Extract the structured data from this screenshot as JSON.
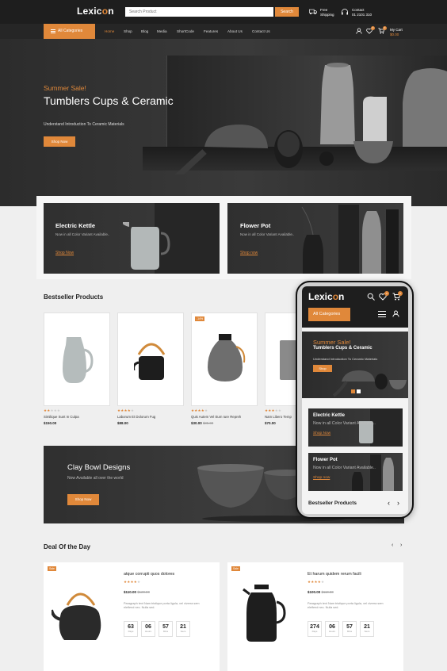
{
  "header": {
    "logo_prefix": "Lexic",
    "logo_o": "o",
    "logo_suffix": "n",
    "search_placeholder": "Search Product",
    "search_button": "Search",
    "free_shipping_1": "Free",
    "free_shipping_2": "Shipping",
    "contact_1": "Contact",
    "contact_2": "01 2101 310",
    "cart_label": "My Cart",
    "cart_total": "$0.00",
    "wishlist_count": "0",
    "cart_count": "0"
  },
  "nav": {
    "all_categories": "All Categories",
    "items": [
      "Home",
      "Shop",
      "Blog",
      "Media",
      "ShortCode",
      "Features",
      "About Us",
      "Contact Us"
    ]
  },
  "hero": {
    "subtitle": "Summer Sale!",
    "title": "Tumblers Cups & Ceramic",
    "description": "Understand Introduction To Ceramic Materials",
    "button": "Shop Now"
  },
  "banners": [
    {
      "title": "Electric Kettle",
      "desc": "Now in all Color Variant Available..",
      "link": "Shop Now"
    },
    {
      "title": "Flower Pot",
      "desc": "Now in all Color Variant Available..",
      "link": "Shop now"
    }
  ],
  "bestseller": {
    "title": "Bestseller Products",
    "products": [
      {
        "name": "Similique Sunt In Culpa",
        "price": "$150.00",
        "old_price": "",
        "rating": 2,
        "badge": ""
      },
      {
        "name": "Laborum Et Dolorum Fug",
        "price": "$88.00",
        "old_price": "",
        "rating": 4,
        "badge": ""
      },
      {
        "name": "Quis Autem Vel Eum Iure Repreh",
        "price": "$30.00",
        "old_price": "$35.00",
        "rating": 4,
        "badge": "-14%"
      },
      {
        "name": "Nam Libero Temp",
        "price": "$70.00",
        "old_price": "",
        "rating": 3,
        "badge": ""
      }
    ]
  },
  "clay": {
    "title": "Clay Bowl Designs",
    "desc": "Now Available all over the world",
    "button": "Shop Now"
  },
  "deal": {
    "title": "Deal Of the Day",
    "items": [
      {
        "badge": "Sale",
        "name": "atque corrupti quos dolores",
        "price": "$110.00",
        "old_price": "$120.00",
        "rating": 4,
        "desc": "Paragraph text Nam tristique porta ligula, vel viverra sem eleifend nec. Nulla sed.",
        "timer": [
          {
            "n": "63",
            "l": "Days"
          },
          {
            "n": "06",
            "l": "Hours"
          },
          {
            "n": "57",
            "l": "Mins"
          },
          {
            "n": "21",
            "l": "Secs"
          }
        ]
      },
      {
        "badge": "Sale",
        "name": "Et harum quidem rerum facili",
        "price": "$100.00",
        "old_price": "$110.00",
        "rating": 4,
        "desc": "Paragraph text Nam tristique porta ligula, vel viverra sem eleifend nec. Nulla sed.",
        "timer": [
          {
            "n": "274",
            "l": "Days"
          },
          {
            "n": "06",
            "l": "Hours"
          },
          {
            "n": "57",
            "l": "Mins"
          },
          {
            "n": "21",
            "l": "Secs"
          }
        ]
      }
    ]
  },
  "phone": {
    "logo_prefix": "Lexic",
    "logo_o": "o",
    "logo_suffix": "n",
    "all_categories": "All Categories",
    "hero_subtitle": "Summer Sale!",
    "hero_title": "Tumblers Cups & Ceramic",
    "hero_desc": "Understand Introduction To Ceramic Materials",
    "hero_button": "Shop",
    "banner1_title": "Electric Kettle",
    "banner1_desc": "Now in all Color Variant Available..",
    "banner1_link": "Shop Now",
    "banner2_title": "Flower Pot",
    "banner2_desc": "Now in all Color Variant Available..",
    "banner2_link": "Shop now",
    "bestseller": "Bestseller Products",
    "badge": "0"
  },
  "colors": {
    "accent": "#e0883a",
    "dark": "#1e1e1e"
  }
}
